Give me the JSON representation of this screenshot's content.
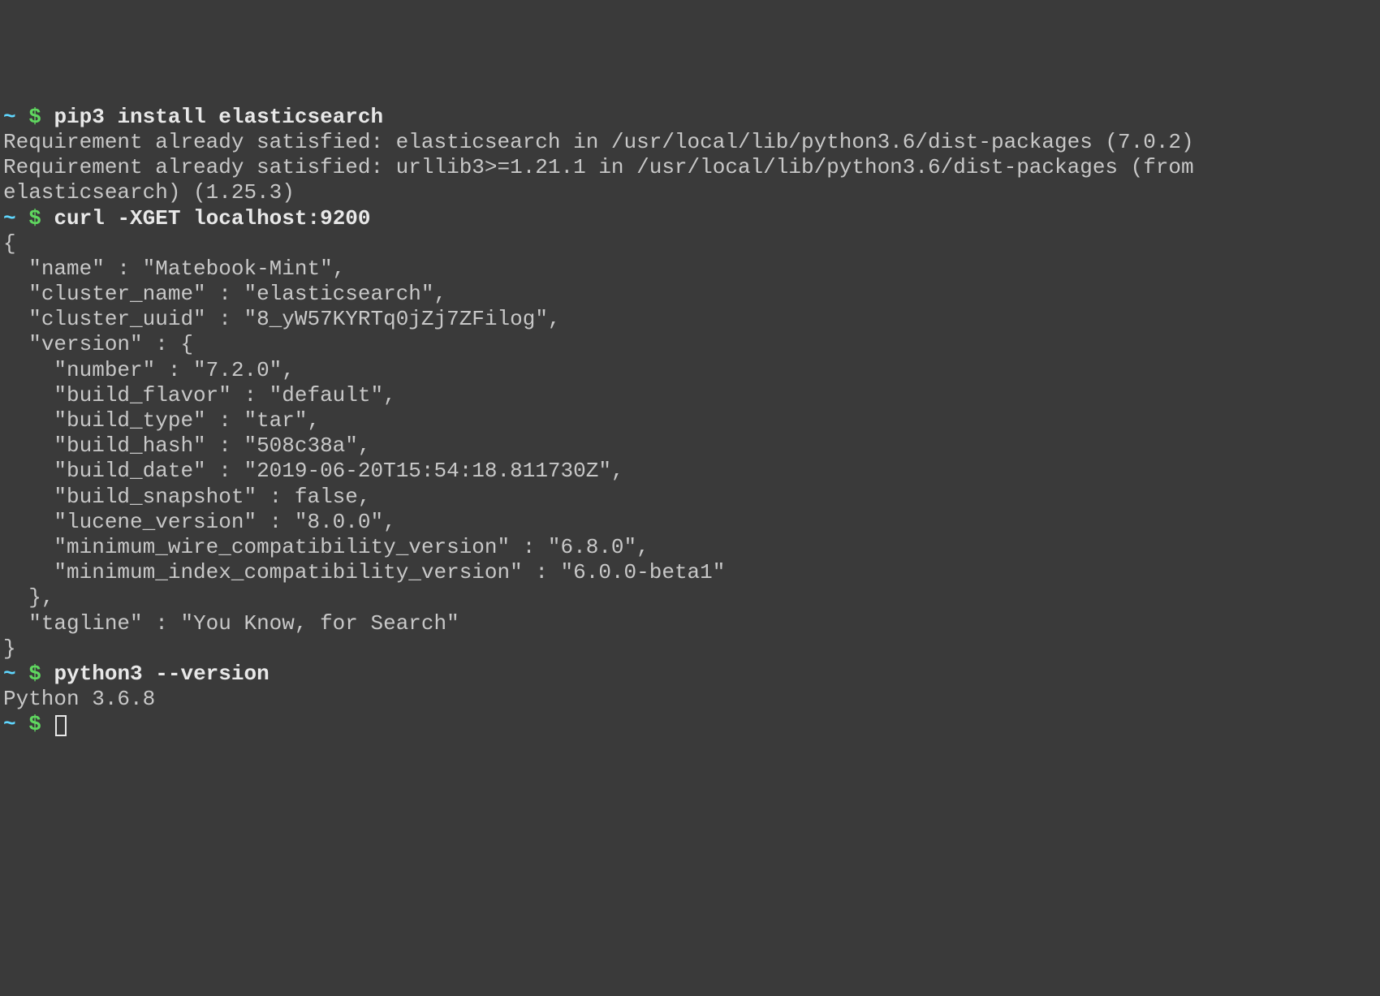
{
  "prompts": {
    "tilde": "~",
    "dollar": "$"
  },
  "commands": {
    "cmd1": "pip3 install elasticsearch",
    "cmd2": "curl -XGET localhost:9200",
    "cmd3": "python3 --version"
  },
  "output": {
    "pip_line1": "Requirement already satisfied: elasticsearch in /usr/local/lib/python3.6/dist-packages (7.0.2)",
    "pip_line2": "Requirement already satisfied: urllib3>=1.21.1 in /usr/local/lib/python3.6/dist-packages (from elasticsearch) (1.25.3)",
    "curl_open": "{",
    "curl_name": "  \"name\" : \"Matebook-Mint\",",
    "curl_cluster_name": "  \"cluster_name\" : \"elasticsearch\",",
    "curl_cluster_uuid": "  \"cluster_uuid\" : \"8_yW57KYRTq0jZj7ZFilog\",",
    "curl_version_open": "  \"version\" : {",
    "curl_number": "    \"number\" : \"7.2.0\",",
    "curl_build_flavor": "    \"build_flavor\" : \"default\",",
    "curl_build_type": "    \"build_type\" : \"tar\",",
    "curl_build_hash": "    \"build_hash\" : \"508c38a\",",
    "curl_build_date": "    \"build_date\" : \"2019-06-20T15:54:18.811730Z\",",
    "curl_build_snapshot": "    \"build_snapshot\" : false,",
    "curl_lucene_version": "    \"lucene_version\" : \"8.0.0\",",
    "curl_min_wire": "    \"minimum_wire_compatibility_version\" : \"6.8.0\",",
    "curl_min_index": "    \"minimum_index_compatibility_version\" : \"6.0.0-beta1\"",
    "curl_version_close": "  },",
    "curl_tagline": "  \"tagline\" : \"You Know, for Search\"",
    "curl_close": "}",
    "python_version": "Python 3.6.8"
  }
}
